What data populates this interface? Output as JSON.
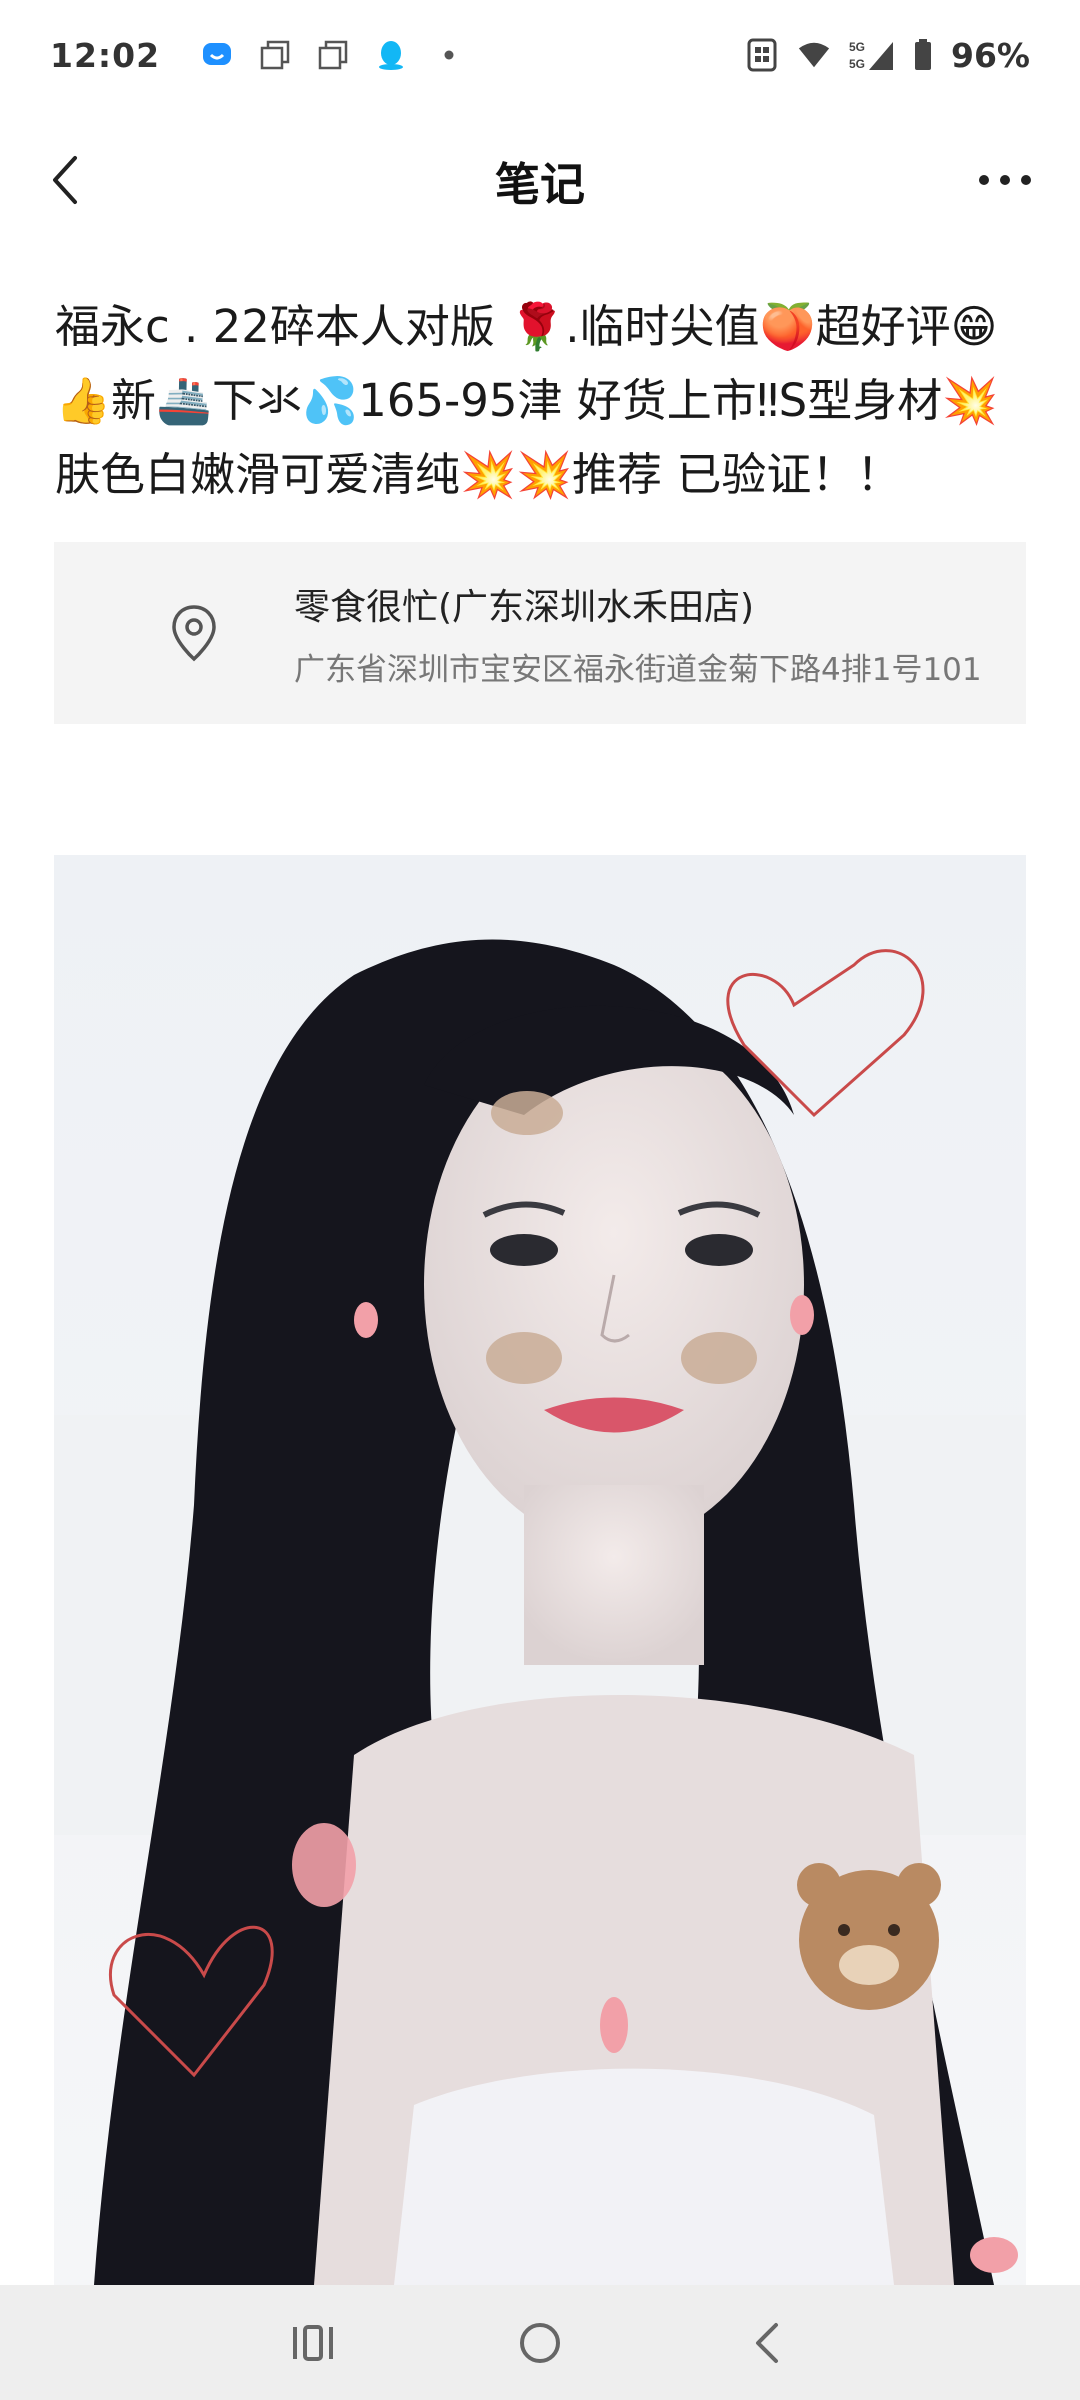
{
  "status_bar": {
    "time": "12:02",
    "battery": "96%",
    "network_label_top": "5G",
    "network_label_bottom": "5G"
  },
  "header": {
    "title": "笔记"
  },
  "note": {
    "text": " 福永c . 22碎本人对版 🌹.临时尖值🍑超好评😁👍新🚢下氺💦165-95津 好货上市‼S型身材💥肤色白嫩滑可爱清纯💥💥推荐 已验证！！"
  },
  "location": {
    "name": "零食很忙(广东深圳水禾田店)",
    "address": "广东省深圳市宝安区福永街道金菊下路4排1号101"
  },
  "icons": {
    "back": "back-arrow-icon",
    "more": "more-dots-icon",
    "pin": "location-pin-icon",
    "nav_recent": "recent-apps-icon",
    "nav_home": "home-icon",
    "nav_back": "nav-back-icon"
  },
  "colors": {
    "card_bg": "#f4f4f4",
    "nav_bg": "#eeeeee"
  }
}
